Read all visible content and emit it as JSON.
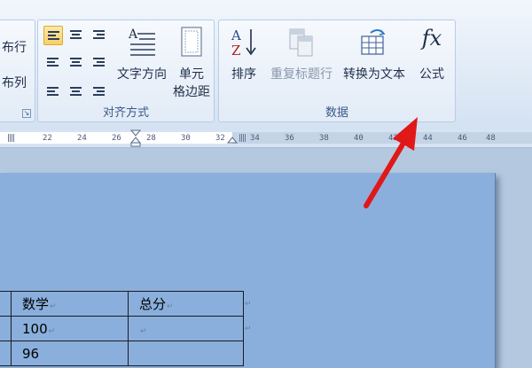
{
  "ribbon": {
    "partial_group": {
      "line1": "布行",
      "line2": "布列"
    },
    "align_group": {
      "label": "对齐方式",
      "text_direction_label": "文字方向",
      "cell_margins_label_1": "单元",
      "cell_margins_label_2": "格边距"
    },
    "data_group": {
      "label": "数据",
      "sort_label": "排序",
      "repeat_header_label": "重复标题行",
      "convert_label": "转换为文本",
      "formula_label": "公式",
      "formula_icon_text": "fx",
      "sort_icon_top": "A",
      "sort_icon_bottom": "Z"
    }
  },
  "ruler": {
    "ticks": [
      "22",
      "24",
      "26",
      "28",
      "30",
      "32",
      "34",
      "36",
      "38",
      "40",
      "42",
      "44",
      "46",
      "48"
    ]
  },
  "table": {
    "rows": [
      [
        "",
        "数学",
        "总分"
      ],
      [
        "",
        "100",
        ""
      ],
      [
        "",
        "96",
        ""
      ]
    ],
    "paragraph_mark": "↵"
  },
  "colors": {
    "arrow": "#e01818",
    "page_selected": "#8aafdd",
    "ribbon_bg": "#dde8f5"
  }
}
